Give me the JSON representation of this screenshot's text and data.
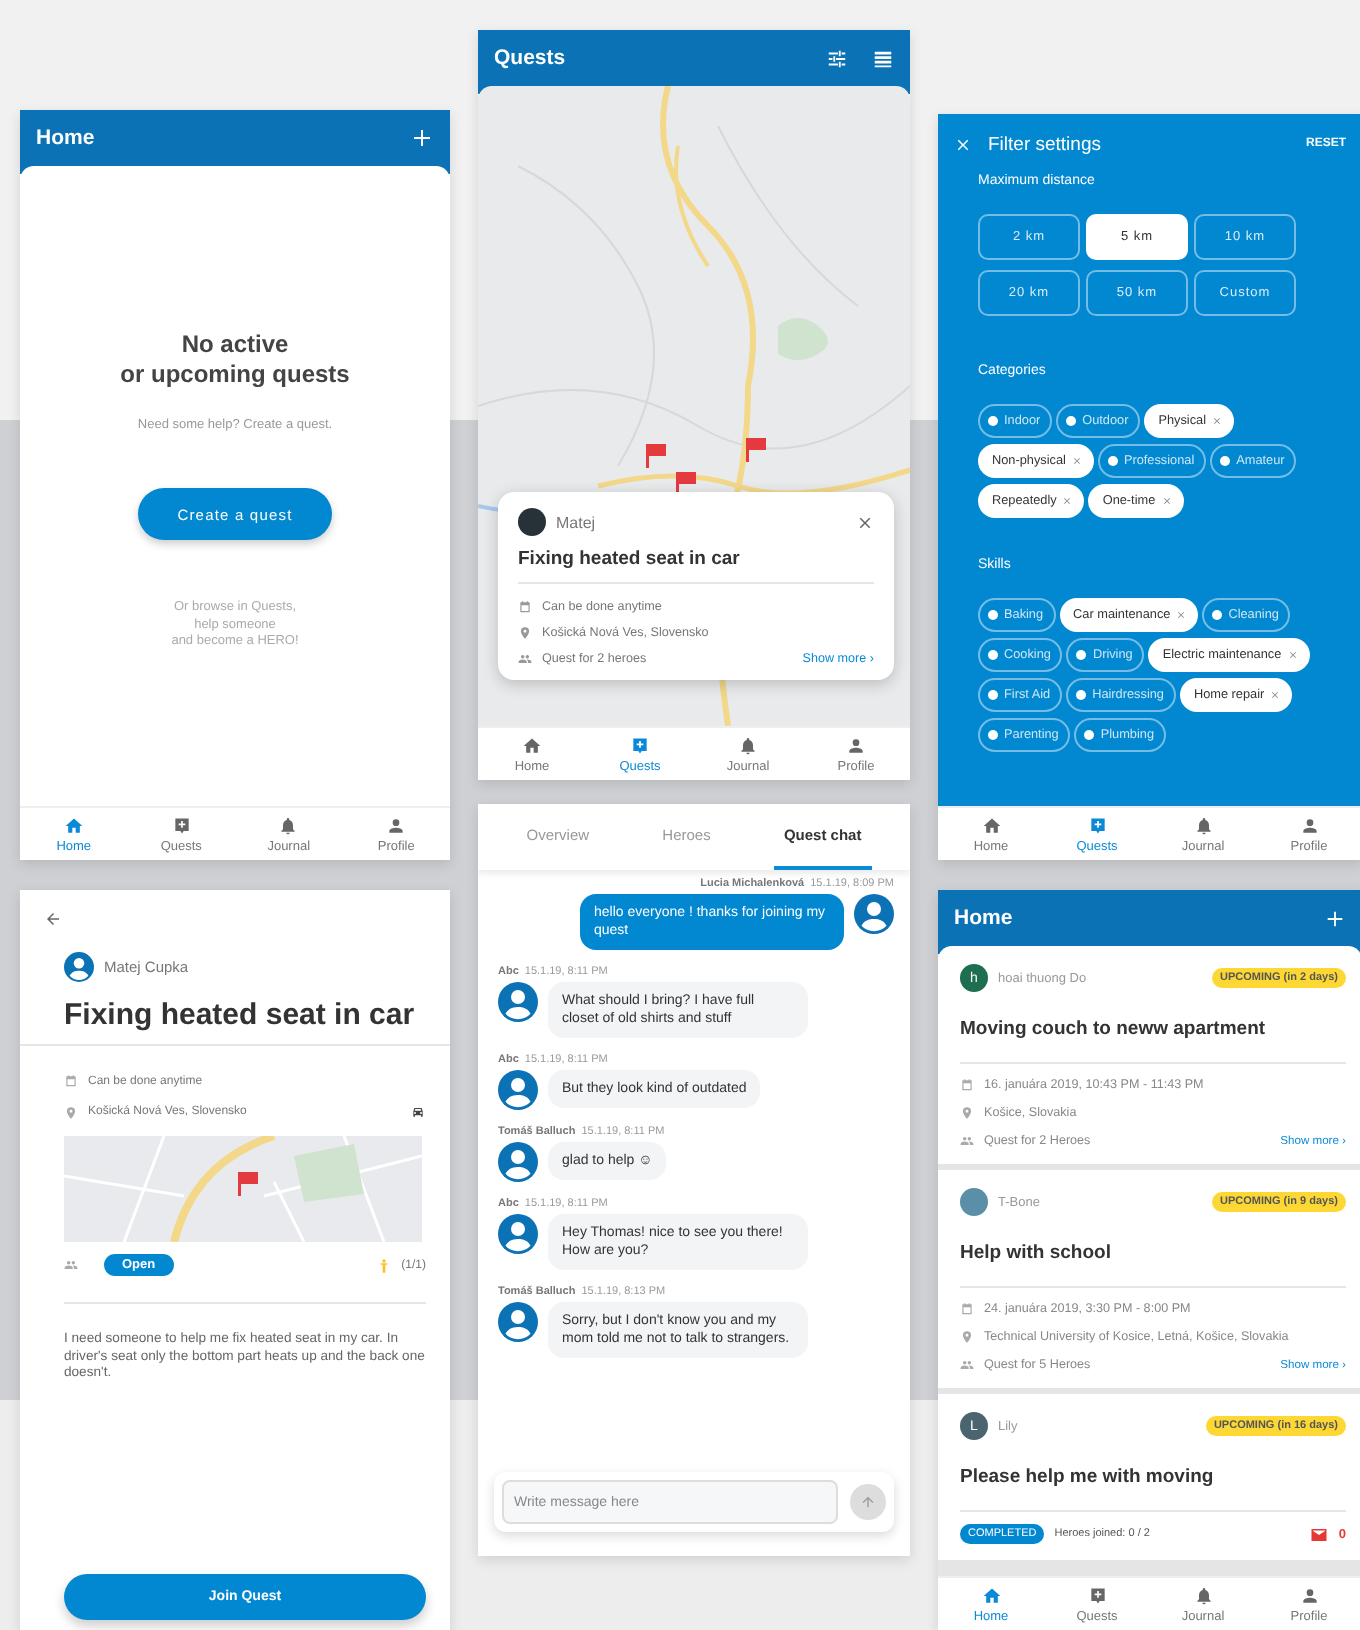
{
  "home_empty": {
    "title": "Home",
    "heading": "No active\nor upcoming quests",
    "hint": "Need some help? Create a quest.",
    "create_button": "Create a quest",
    "browse_text": "Or browse in Quests,\nhelp someone\nand become a HERO!",
    "nav": [
      {
        "label": "Home",
        "selected": true
      },
      {
        "label": "Quests",
        "selected": false
      },
      {
        "label": "Journal",
        "selected": false
      },
      {
        "label": "Profile",
        "selected": false
      }
    ]
  },
  "quests_map": {
    "title": "Quests",
    "card": {
      "author": "Matej",
      "title": "Fixing heated seat in car",
      "time": "Can be done anytime",
      "place": "Košická Nová Ves, Slovensko",
      "heroes": "Quest for 2 heroes",
      "link": "Show more ›"
    },
    "nav": [
      {
        "label": "Home",
        "selected": false
      },
      {
        "label": "Quests",
        "selected": true
      },
      {
        "label": "Journal",
        "selected": false
      },
      {
        "label": "Profile",
        "selected": false
      }
    ]
  },
  "filter": {
    "title": "Filter settings",
    "reset": "RESET",
    "distance_label": "Maximum distance",
    "distances": [
      {
        "label": "2 km",
        "selected": false
      },
      {
        "label": "5 km",
        "selected": true
      },
      {
        "label": "10 km",
        "selected": false
      },
      {
        "label": "20 km",
        "selected": false
      },
      {
        "label": "50 km",
        "selected": false
      },
      {
        "label": "Custom",
        "selected": false
      }
    ],
    "categories_label": "Categories",
    "categories": [
      {
        "label": "Indoor",
        "selected": false
      },
      {
        "label": "Outdoor",
        "selected": false
      },
      {
        "label": "Physical",
        "selected": true
      },
      {
        "label": "Non-physical",
        "selected": true
      },
      {
        "label": "Professional",
        "selected": false
      },
      {
        "label": "Amateur",
        "selected": false
      },
      {
        "label": "Repeatedly",
        "selected": true
      },
      {
        "label": "One-time",
        "selected": true
      }
    ],
    "skills_label": "Skills",
    "skills": [
      {
        "label": "Baking",
        "selected": false
      },
      {
        "label": "Car maintenance",
        "selected": true
      },
      {
        "label": "Cleaning",
        "selected": false
      },
      {
        "label": "Cooking",
        "selected": false
      },
      {
        "label": "Driving",
        "selected": false
      },
      {
        "label": "Electric maintenance",
        "selected": true
      },
      {
        "label": "First Aid",
        "selected": false
      },
      {
        "label": "Hairdressing",
        "selected": false
      },
      {
        "label": "Home repair",
        "selected": true
      },
      {
        "label": "Parenting",
        "selected": false
      },
      {
        "label": "Plumbing",
        "selected": false
      }
    ],
    "nav": [
      {
        "label": "Home",
        "selected": false
      },
      {
        "label": "Quests",
        "selected": true
      },
      {
        "label": "Journal",
        "selected": false
      },
      {
        "label": "Profile",
        "selected": false
      }
    ]
  },
  "quest_detail": {
    "author": "Matej Cupka",
    "title": "Fixing heated seat in car",
    "time": "Can be done anytime",
    "place": "Košická Nová Ves, Slovensko",
    "status": "Open",
    "heroes_count": "(1/1)",
    "description": "I need someone to help me fix heated seat in my car. In driver's seat only the bottom part heats up and the back one doesn't.",
    "join_button": "Join Quest"
  },
  "chat": {
    "tabs": [
      {
        "label": "Overview",
        "selected": false
      },
      {
        "label": "Heroes",
        "selected": false
      },
      {
        "label": "Quest chat",
        "selected": true
      }
    ],
    "messages": [
      {
        "author": "Lucia Michalenková",
        "time": "15.1.19, 8:09 PM",
        "text": "hello everyone ! thanks for joining my quest",
        "own": true
      },
      {
        "author": "Abc",
        "time": "15.1.19, 8:11 PM",
        "text": "What should I bring? I have full closet of old shirts and stuff",
        "own": false
      },
      {
        "author": "Abc",
        "time": "15.1.19, 8:11 PM",
        "text": "But they look kind of outdated",
        "own": false
      },
      {
        "author": "Tomáš Balluch",
        "time": "15.1.19, 8:11 PM",
        "text": "glad to help ☺",
        "own": false
      },
      {
        "author": "Abc",
        "time": "15.1.19, 8:11 PM",
        "text": "Hey Thomas! nice to see you there! How are you?",
        "own": false
      },
      {
        "author": "Tomáš Balluch",
        "time": "15.1.19, 8:13 PM",
        "text": "Sorry, but I don't know you and my mom told me not to talk to strangers.",
        "own": false
      }
    ],
    "input": {
      "placeholder": "Write message here"
    }
  },
  "home_list": {
    "title": "Home",
    "quests": [
      {
        "kind": "details",
        "avatar": {
          "kind": "letter",
          "letter": "h",
          "color": "#1e6e50"
        },
        "author": "hoai thuong Do",
        "badge": "UPCOMING (in 2 days)",
        "title": "Moving couch to neww apartment",
        "date": "16. januára 2019, 10:43 PM - 11:43 PM",
        "place": "Košice, Slovakia",
        "heroes": "Quest for 2 Heroes",
        "link": "Show more ›"
      },
      {
        "kind": "details",
        "avatar": {
          "kind": "photo"
        },
        "author": "T-Bone",
        "badge": "UPCOMING (in 9 days)",
        "title": "Help with school",
        "date": "24. januára 2019, 3:30 PM - 8:00 PM",
        "place": "Technical University of Kosice, Letná, Košice, Slovakia",
        "heroes": "Quest for 5 Heroes",
        "link": "Show more ›"
      },
      {
        "kind": "summary",
        "avatar": {
          "kind": "letter",
          "letter": "L",
          "color": "#4a6470"
        },
        "author": "Lily",
        "badge": "UPCOMING (in 16 days)",
        "title": "Please help me with moving",
        "status": "COMPLETED",
        "joined": "Heroes joined: 0 / 2",
        "mail_count": "0"
      }
    ],
    "nav": [
      {
        "label": "Home",
        "selected": true
      },
      {
        "label": "Quests",
        "selected": false
      },
      {
        "label": "Journal",
        "selected": false
      },
      {
        "label": "Profile",
        "selected": false
      }
    ]
  }
}
